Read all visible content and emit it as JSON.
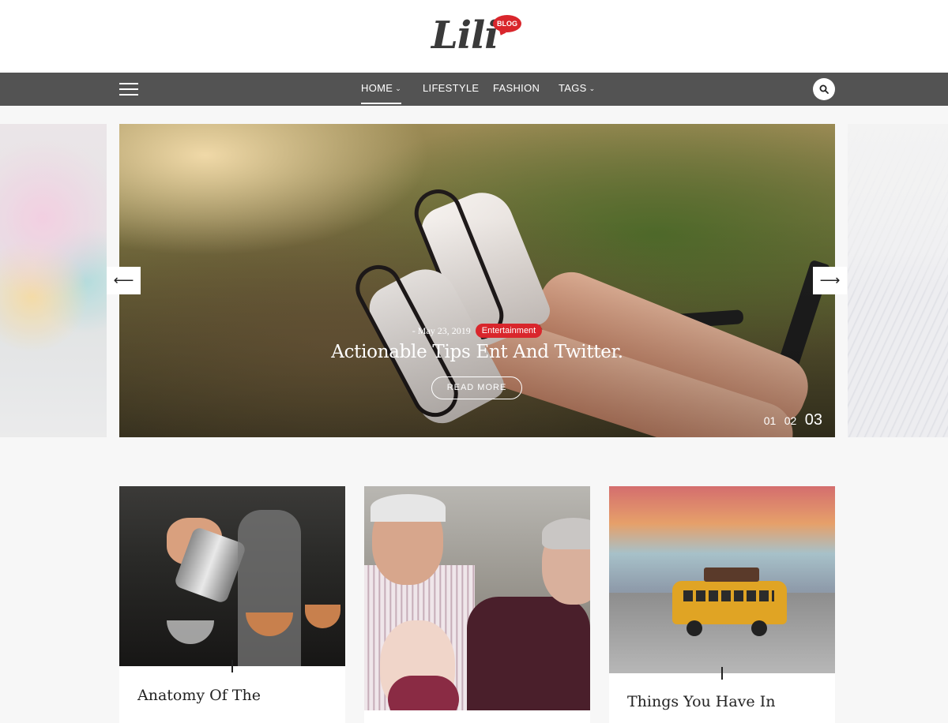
{
  "logo": {
    "text": "Lili",
    "badge": "BLOG"
  },
  "nav": {
    "items": [
      {
        "label": "HOME",
        "caret": true,
        "active": true
      },
      {
        "label": "LIFESTYLE",
        "caret": false,
        "active": false
      },
      {
        "label": "FASHION",
        "caret": false,
        "active": false
      },
      {
        "label": "TAGS",
        "caret": true,
        "active": false
      }
    ],
    "caret_glyph": "❯"
  },
  "slider": {
    "date": "- May 23, 2019",
    "category": "Entertainment",
    "title": "Actionable Tips Ent And Twitter.",
    "button": "READ MORE",
    "pages": [
      "01",
      "02",
      "03"
    ],
    "current_page": "03",
    "prev_arrow": "⟵",
    "next_arrow": "⟶"
  },
  "cards": [
    {
      "title": "Anatomy Of The"
    },
    {
      "title": ""
    },
    {
      "title": "Things You Have In"
    }
  ],
  "colors": {
    "accent": "#d9262c",
    "navbar": "#535353",
    "background": "#f7f7f7"
  }
}
